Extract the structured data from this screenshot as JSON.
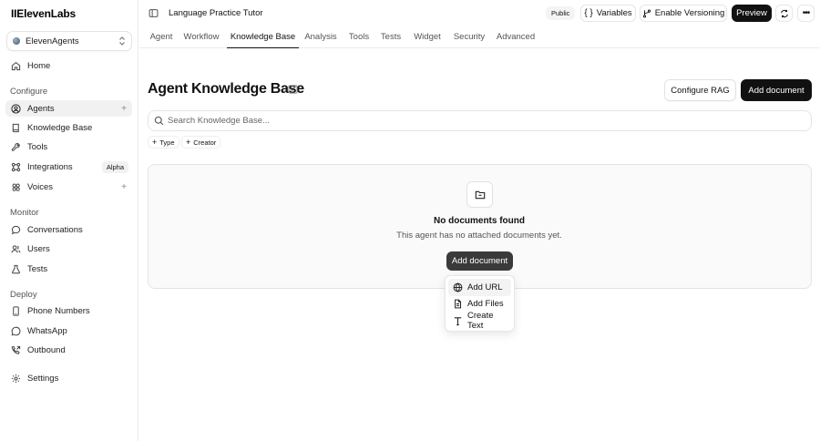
{
  "brand": {
    "logo": "IIElevenLabs"
  },
  "workspace": {
    "label": "ElevenAgents"
  },
  "sidebar": {
    "home": "Home",
    "configure_label": "Configure",
    "configure": [
      {
        "label": "Agents",
        "icon": "bot-icon"
      },
      {
        "label": "Knowledge Base",
        "icon": "book-icon"
      },
      {
        "label": "Tools",
        "icon": "wrench-icon"
      },
      {
        "label": "Integrations",
        "icon": "integration-icon",
        "badge": "Alpha"
      },
      {
        "label": "Voices",
        "icon": "voices-icon"
      }
    ],
    "monitor_label": "Monitor",
    "monitor": [
      {
        "label": "Conversations",
        "icon": "chat-icon"
      },
      {
        "label": "Users",
        "icon": "users-icon"
      },
      {
        "label": "Tests",
        "icon": "tests-icon"
      }
    ],
    "deploy_label": "Deploy",
    "deploy": [
      {
        "label": "Phone Numbers",
        "icon": "phone-icon"
      },
      {
        "label": "WhatsApp",
        "icon": "whatsapp-icon"
      },
      {
        "label": "Outbound",
        "icon": "outbound-icon"
      }
    ],
    "settings": "Settings"
  },
  "topbar": {
    "title": "Language Practice Tutor",
    "public": "Public",
    "variables": "Variables",
    "versioning": "Enable Versioning",
    "preview": "Preview"
  },
  "tabs": [
    "Agent",
    "Workflow",
    "Knowledge Base",
    "Analysis",
    "Tools",
    "Tests",
    "Widget",
    "Security",
    "Advanced"
  ],
  "active_tab": "Knowledge Base",
  "main": {
    "title": "Agent Knowledge Base",
    "configure_rag": "Configure RAG",
    "add_document": "Add document",
    "search_placeholder": "Search Knowledge Base...",
    "filters": [
      "Type",
      "Creator"
    ],
    "empty_title": "No documents found",
    "empty_subtitle": "This agent has no attached documents yet.",
    "empty_button": "Add document"
  },
  "dropdown": {
    "items": [
      {
        "label": "Add URL",
        "icon": "globe-icon"
      },
      {
        "label": "Add Files",
        "icon": "file-icon"
      },
      {
        "label": "Create Text",
        "icon": "text-icon"
      }
    ]
  }
}
